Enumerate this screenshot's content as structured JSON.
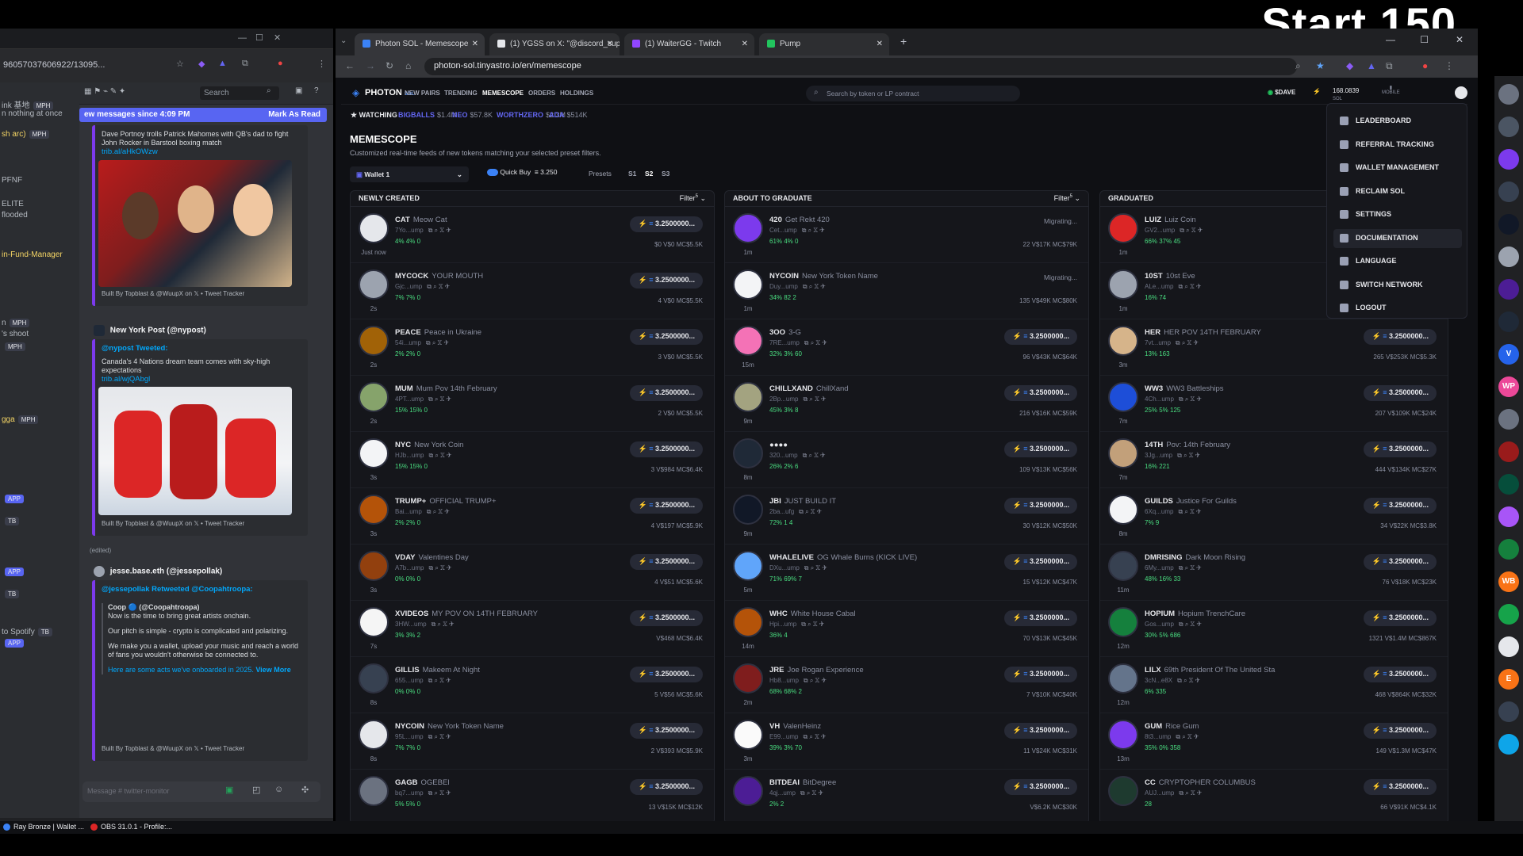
{
  "overlay_text": "Start 150",
  "left_browser": {
    "url": "96057037606922/13095...",
    "discord": {
      "search_placeholder": "Search",
      "new_messages": "ew messages since 4:09 PM",
      "mark_as_read": "Mark As Read",
      "msg1_text": "Dave Portnoy trolls Patrick Mahomes with QB's dad to fight John Rocker in Barstool boxing match",
      "msg1_link": "trib.al/aHkOWzw",
      "footer": "Built By Topblast & @WuupX on 𝕏  •  Tweet Tracker",
      "msg2_author": "New York Post (@nypost)",
      "msg2_tweeted": "@nypost Tweeted:",
      "msg2_text": "Canada's 4 Nations dream team comes with sky-high expectations",
      "msg2_link": "trib.al/wjQAbgl",
      "msg3_author": "jesse.base.eth (@jessepollak)",
      "msg3_retweet": "@jessepollak Retweeted @Coopahtroopa:",
      "msg3_coop": "Coop 🔵 (@Coopahtroopa)",
      "msg3_p1": "Now is the time to bring great artists onchain.",
      "msg3_p2": "Our pitch is simple - crypto is complicated and polarizing.",
      "msg3_p3": "We make you a wallet, upload your music and reach a world of fans you wouldn't otherwise be connected to.",
      "msg3_p4": "Here are some acts we've onboarded in 2025.",
      "msg3_view": "View More",
      "message_placeholder": "Message # twitter-monitor",
      "edited": "(edited)"
    },
    "channels": [
      {
        "label": "ink 基地",
        "badge": "MPH"
      },
      {
        "label": "n nothing at once",
        "badge": ""
      },
      {
        "label": "sh arc)",
        "badge": "MPH"
      },
      {
        "label": "PFNF",
        "badge": ""
      },
      {
        "label": "ELITE",
        "badge": ""
      },
      {
        "label": "flooded",
        "badge": ""
      },
      {
        "label": "in-Fund-Manager",
        "badge": ""
      },
      {
        "label": "n",
        "badge": "MPH"
      },
      {
        "label": "'s shoot",
        "badge": ""
      },
      {
        "label": "",
        "badge": "MPH"
      },
      {
        "label": "gga",
        "badge": "MPH"
      },
      {
        "label": "",
        "badge": "APP"
      },
      {
        "label": "",
        "badge": "TB"
      },
      {
        "label": "",
        "badge": "APP"
      },
      {
        "label": "",
        "badge": "TB"
      },
      {
        "label": "to Spotify",
        "badge": "TB"
      },
      {
        "label": "",
        "badge": "APP"
      }
    ]
  },
  "tabs": [
    {
      "label": "Photon SOL - Memescope",
      "icon": "photon-icon"
    },
    {
      "label": "(1) YGSS on X: \"@discord_supp",
      "icon": "x-icon"
    },
    {
      "label": "(1) WaiterGG - Twitch",
      "icon": "twitch-icon"
    },
    {
      "label": "Pump",
      "icon": "pump-icon"
    }
  ],
  "url": "photon-sol.tinyastro.io/en/memescope",
  "photon": {
    "logo": "PHOTON",
    "logo_sub": "SOL",
    "nav": [
      "NEW PAIRS",
      "TRENDING",
      "MEMESCOPE",
      "ORDERS",
      "HOLDINGS"
    ],
    "search_placeholder": "Search by token or LP contract",
    "dave": "$DAVE",
    "balance": "168.0839",
    "balance_sub": "SOL",
    "mobile": "MOBILE",
    "watching": "WATCHING",
    "ticker": [
      {
        "name": "BIGBALLS",
        "val": "$1.4M"
      },
      {
        "name": "NEO",
        "val": "$57.8K"
      },
      {
        "name": "WORTHZERO",
        "val": "$2.3M"
      },
      {
        "name": "ADA",
        "val": "$514K"
      }
    ],
    "title": "MEMESCOPE",
    "subtitle": "Customized real-time feeds of new tokens matching your selected preset filters.",
    "wallet": "Wallet 1",
    "quick_buy": "Quick Buy",
    "quick_amt": "3.250",
    "presets": "Presets",
    "preset_opts": [
      "S1",
      "S2",
      "S3"
    ],
    "filter_label": "Filter",
    "filter_count": "5"
  },
  "columns": [
    {
      "title": "NEWLY CREATED",
      "rows": [
        {
          "sym": "CAT",
          "name": "Meow Cat",
          "age": "Just now",
          "ca": "7Yo...ump",
          "stats": "4% 4% 0",
          "buy": "3.2500000...",
          "mc": "$0 V$0 MC$5.5K",
          "color": "#e5e7eb"
        },
        {
          "sym": "MYCOCK",
          "name": "YOUR MOUTH",
          "age": "2s",
          "ca": "Gjc...ump",
          "stats": "7% 7% 0",
          "buy": "3.2500000...",
          "mc": "4 V$0 MC$5.5K",
          "color": "#9ca3af"
        },
        {
          "sym": "PEACE",
          "name": "Peace in Ukraine",
          "age": "2s",
          "ca": "54i...ump",
          "stats": "2% 2% 0",
          "buy": "3.2500000...",
          "mc": "3 V$0 MC$5.5K",
          "color": "#a16207"
        },
        {
          "sym": "MUM",
          "name": "Mum Pov 14th February",
          "age": "2s",
          "ca": "4PT...ump",
          "stats": "15% 15% 0",
          "buy": "3.2500000...",
          "mc": "2 V$0 MC$5.5K",
          "color": "#86a36b"
        },
        {
          "sym": "NYC",
          "name": "New York Coin",
          "age": "3s",
          "ca": "HJb...ump",
          "stats": "15% 15% 0",
          "buy": "3.2500000...",
          "mc": "3 V$984 MC$6.4K",
          "color": "#f3f4f6"
        },
        {
          "sym": "TRUMP+",
          "name": "OFFICIAL TRUMP+",
          "age": "3s",
          "ca": "Bai...ump",
          "stats": "2% 2% 0",
          "buy": "3.2500000...",
          "mc": "4 V$197 MC$5.9K",
          "color": "#b45309"
        },
        {
          "sym": "VDAY",
          "name": "Valentines Day",
          "age": "3s",
          "ca": "A7b...ump",
          "stats": "0% 0% 0",
          "buy": "3.2500000...",
          "mc": "4 V$51 MC$5.6K",
          "color": "#92400e"
        },
        {
          "sym": "XVIDEOS",
          "name": "MY POV ON 14TH FEBRUARY",
          "age": "7s",
          "ca": "3HW...ump",
          "stats": "3% 3% 2",
          "buy": "3.2500000...",
          "mc": "V$468 MC$6.4K",
          "color": "#f5f5f5"
        },
        {
          "sym": "GILLIS",
          "name": "Makeem At Night",
          "age": "8s",
          "ca": "655...ump",
          "stats": "0% 0% 0",
          "buy": "3.2500000...",
          "mc": "5 V$56 MC$5.6K",
          "color": "#374151"
        },
        {
          "sym": "NYCOIN",
          "name": "New York Token Name",
          "age": "8s",
          "ca": "95L...ump",
          "stats": "7% 7% 0",
          "buy": "3.2500000...",
          "mc": "2 V$393 MC$5.9K",
          "color": "#e5e7eb"
        },
        {
          "sym": "GAGB",
          "name": "OGEBEI",
          "age": "",
          "ca": "bq7...ump",
          "stats": "5% 5% 0",
          "buy": "3.2500000...",
          "mc": "13 V$15K MC$12K",
          "color": "#6b7280"
        }
      ]
    },
    {
      "title": "ABOUT TO GRADUATE",
      "rows": [
        {
          "sym": "420",
          "name": "Get Rekt 420",
          "age": "1m",
          "ca": "Cet...ump",
          "stats": "61% 4% 0",
          "mig": "Migrating...",
          "mc": "22 V$17K MC$79K",
          "color": "#7c3aed"
        },
        {
          "sym": "NYCOIN",
          "name": "New York Token Name",
          "age": "1m",
          "ca": "Duy...ump",
          "stats": "34% 82 2",
          "mig": "Migrating...",
          "mc": "135 V$49K MC$80K",
          "color": "#f3f4f6"
        },
        {
          "sym": "3OO",
          "name": "3-G",
          "age": "15m",
          "ca": "7RE...ump",
          "stats": "32% 3% 60",
          "buy": "3.2500000...",
          "mc": "96 V$43K MC$64K",
          "color": "#f472b6"
        },
        {
          "sym": "CHILLXAND",
          "name": "ChillXand",
          "age": "9m",
          "ca": "2Bp...ump",
          "stats": "45% 3% 8",
          "buy": "3.2500000...",
          "mc": "216 V$16K MC$59K",
          "color": "#a3a380"
        },
        {
          "sym": "●●●●",
          "name": "",
          "age": "8m",
          "ca": "320...ump",
          "stats": "26% 2% 6",
          "buy": "3.2500000...",
          "mc": "109 V$13K MC$56K",
          "color": "#1f2937"
        },
        {
          "sym": "JBI",
          "name": "JUST BUILD IT",
          "age": "9m",
          "ca": "2ba...ufg",
          "stats": "72% 1 4",
          "buy": "3.2500000...",
          "mc": "30 V$12K MC$50K",
          "color": "#111827"
        },
        {
          "sym": "WHALELIVE",
          "name": "OG Whale Burns (KICK LIVE)",
          "age": "5m",
          "ca": "DXu...ump",
          "stats": "71% 69% 7",
          "buy": "3.2500000...",
          "mc": "15 V$12K MC$47K",
          "color": "#60a5fa"
        },
        {
          "sym": "WHC",
          "name": "White House Cabal",
          "age": "14m",
          "ca": "Hpi...ump",
          "stats": "36% 4",
          "buy": "3.2500000...",
          "mc": "70 V$13K MC$45K",
          "color": "#b45309"
        },
        {
          "sym": "JRE",
          "name": "Joe Rogan Experience",
          "age": "2m",
          "ca": "Hb8...ump",
          "stats": "68% 68% 2",
          "buy": "3.2500000...",
          "mc": "7 V$10K MC$40K",
          "color": "#7f1d1d"
        },
        {
          "sym": "VH",
          "name": "ValenHeinz",
          "age": "3m",
          "ca": "E99...ump",
          "stats": "39% 3% 70",
          "buy": "3.2500000...",
          "mc": "11 V$24K MC$31K",
          "color": "#fafafa"
        },
        {
          "sym": "BITDEAI",
          "name": "BitDegree",
          "age": "",
          "ca": "4qj...ump",
          "stats": "2% 2",
          "buy": "3.2500000...",
          "mc": "V$6.2K MC$30K",
          "color": "#4c1d95"
        }
      ]
    },
    {
      "title": "GRADUATED",
      "rows": [
        {
          "sym": "LUIZ",
          "name": "Luiz Coin",
          "age": "1m",
          "ca": "GV2...ump",
          "stats": "66% 37% 45",
          "buy": "",
          "mc": "",
          "color": "#dc2626"
        },
        {
          "sym": "10ST",
          "name": "10st Eve",
          "age": "1m",
          "ca": "ALe...ump",
          "stats": "16% 74",
          "buy": "",
          "mc": "",
          "color": "#9ca3af"
        },
        {
          "sym": "HER",
          "name": "HER POV 14TH FEBRUARY",
          "age": "3m",
          "ca": "7vt...ump",
          "stats": "13% 163",
          "buy": "3.2500000...",
          "mc": "265 V$253K MC$5.3K",
          "color": "#d6b48a"
        },
        {
          "sym": "WW3",
          "name": "WW3 Battleships",
          "age": "7m",
          "ca": "4Ch...ump",
          "stats": "25% 5% 125",
          "buy": "3.2500000...",
          "mc": "207 V$109K MC$24K",
          "color": "#1d4ed8"
        },
        {
          "sym": "14TH",
          "name": "Pov: 14th February",
          "age": "7m",
          "ca": "3Jg...ump",
          "stats": "16% 221",
          "buy": "3.2500000...",
          "mc": "444 V$134K MC$27K",
          "color": "#c2a07a"
        },
        {
          "sym": "GUILDS",
          "name": "Justice For Guilds",
          "age": "8m",
          "ca": "6Xq...ump",
          "stats": "7% 9",
          "buy": "3.2500000...",
          "mc": "34 V$22K MC$3.8K",
          "color": "#f3f4f6"
        },
        {
          "sym": "DMRISING",
          "name": "Dark Moon Rising",
          "age": "11m",
          "ca": "6My...ump",
          "stats": "48% 16% 33",
          "buy": "3.2500000...",
          "mc": "76 V$18K MC$23K",
          "color": "#374151"
        },
        {
          "sym": "HOPIUM",
          "name": "Hopium TrenchCare",
          "age": "12m",
          "ca": "Gos...ump",
          "stats": "30% 5% 686",
          "buy": "3.2500000...",
          "mc": "1321 V$1.4M MC$867K",
          "color": "#15803d"
        },
        {
          "sym": "LILX",
          "name": "69th President Of The United Sta",
          "age": "12m",
          "ca": "3cN...e8X",
          "stats": "6% 335",
          "buy": "3.2500000...",
          "mc": "468 V$864K MC$32K",
          "color": "#64748b"
        },
        {
          "sym": "GUM",
          "name": "Rice Gum",
          "age": "13m",
          "ca": "8t3...ump",
          "stats": "35% 0% 358",
          "buy": "3.2500000...",
          "mc": "149 V$1.3M MC$47K",
          "color": "#7c3aed"
        },
        {
          "sym": "CC",
          "name": "CRYPTOPHER COLUMBUS",
          "age": "",
          "ca": "AUJ...ump",
          "stats": "28",
          "buy": "3.2500000...",
          "mc": "66 V$91K MC$4.1K",
          "color": "#1e3a2f"
        }
      ]
    }
  ],
  "menu": [
    {
      "label": "LEADERBOARD",
      "icon": "trophy-icon"
    },
    {
      "label": "REFERRAL TRACKING",
      "icon": "users-icon"
    },
    {
      "label": "WALLET MANAGEMENT",
      "icon": "wallet-icon"
    },
    {
      "label": "RECLAIM SOL",
      "icon": "coin-icon"
    },
    {
      "label": "SETTINGS",
      "icon": "gear-icon"
    },
    {
      "label": "DOCUMENTATION",
      "icon": "doc-icon"
    },
    {
      "label": "LANGUAGE",
      "icon": "globe-icon"
    },
    {
      "label": "SWITCH NETWORK",
      "icon": "network-icon"
    },
    {
      "label": "LOGOUT",
      "icon": "logout-icon"
    }
  ],
  "right_bar": [
    {
      "label": "",
      "color": "#6b7280"
    },
    {
      "label": "",
      "color": "#4b5563"
    },
    {
      "label": "",
      "color": "#7c3aed"
    },
    {
      "label": "",
      "color": "#374151"
    },
    {
      "label": "",
      "color": "#111827"
    },
    {
      "label": "",
      "color": "#9ca3af"
    },
    {
      "label": "",
      "color": "#4c1d95"
    },
    {
      "label": "",
      "color": "#1f2937"
    },
    {
      "label": "V",
      "color": "#2563eb"
    },
    {
      "label": "WP",
      "color": "#ec4899"
    },
    {
      "label": "",
      "color": "#6b7280"
    },
    {
      "label": "",
      "color": "#991b1b"
    },
    {
      "label": "",
      "color": "#064e3b"
    },
    {
      "label": "",
      "color": "#a855f7"
    },
    {
      "label": "",
      "color": "#15803d"
    },
    {
      "label": "WB",
      "color": "#f97316"
    },
    {
      "label": "",
      "color": "#16a34a"
    },
    {
      "label": "",
      "color": "#e5e7eb"
    },
    {
      "label": "E",
      "color": "#f97316"
    },
    {
      "label": "",
      "color": "#374151"
    },
    {
      "label": "",
      "color": "#0ea5e9"
    }
  ],
  "taskbar": [
    {
      "label": "Ray Bronze | Wallet ..."
    },
    {
      "label": "OBS 31.0.1 - Profile:..."
    }
  ],
  "colors": {
    "accent": "#5865f2",
    "photon_blue": "#3b82f6",
    "green": "#4ade80",
    "red": "#f87171"
  }
}
